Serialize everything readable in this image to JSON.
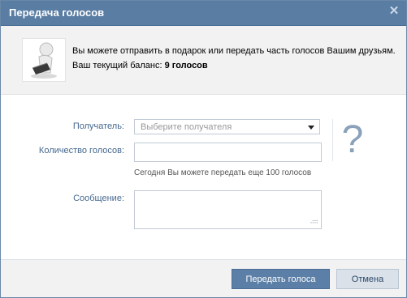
{
  "dialog": {
    "title": "Передача голосов",
    "close_icon": "close-icon"
  },
  "info": {
    "line1": "Вы можете отправить в подарок или передать часть голосов Вашим друзьям.",
    "balance_prefix": "Ваш текущий баланс: ",
    "balance_value": "9 голосов",
    "avatar_icon": "gift-figure-icon"
  },
  "form": {
    "recipient_label": "Получатель:",
    "recipient_placeholder": "Выберите получателя",
    "amount_label": "Количество голосов:",
    "amount_value": "",
    "amount_hint": "Сегодня Вы можете передать еще 100 голосов",
    "message_label": "Сообщение:",
    "message_value": "",
    "help_symbol": "?"
  },
  "footer": {
    "submit_label": "Передать голоса",
    "cancel_label": "Отмена"
  }
}
